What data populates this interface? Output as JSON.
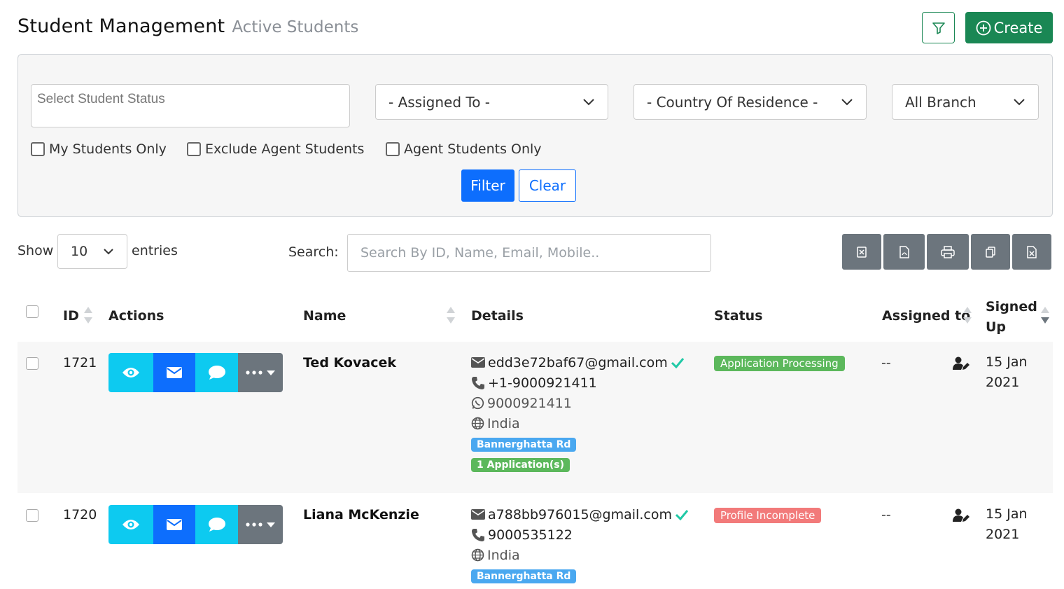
{
  "header": {
    "title": "Student Management",
    "subtitle": "Active Students",
    "create_label": "Create"
  },
  "filters": {
    "status_placeholder": "Select Student Status",
    "assigned_to": "- Assigned To -",
    "country": "- Country Of Residence -",
    "branch": "All Branch",
    "checkbox_my_students": "My Students Only",
    "checkbox_exclude_agent": "Exclude Agent Students",
    "checkbox_agent_only": "Agent Students Only",
    "filter_label": "Filter",
    "clear_label": "Clear"
  },
  "table_controls": {
    "show_label": "Show",
    "entries_value": "10",
    "entries_label": "entries",
    "search_label": "Search:",
    "search_placeholder": "Search By ID, Name, Email, Mobile.."
  },
  "columns": {
    "id": "ID",
    "actions": "Actions",
    "name": "Name",
    "details": "Details",
    "status": "Status",
    "assigned_to": "Assigned to",
    "signed_up": "Signed Up"
  },
  "rows": [
    {
      "id": "1721",
      "name": "Ted Kovacek",
      "email": "edd3e72baf67@gmail.com",
      "phone": "+1-9000921411",
      "whatsapp": "9000921411",
      "country": "India",
      "branch": "Bannerghatta Rd",
      "applications": "1 Application(s)",
      "status": "Application Processing",
      "assigned": "--",
      "signed_day": "15 Jan",
      "signed_year": "2021"
    },
    {
      "id": "1720",
      "name": "Liana McKenzie",
      "email": "a788bb976015@gmail.com",
      "phone": "9000535122",
      "country": "India",
      "branch": "Bannerghatta Rd",
      "status": "Profile Incomplete",
      "assigned": "--",
      "signed_day": "15 Jan",
      "signed_year": "2021"
    }
  ],
  "colors": {
    "primary": "#0d6efd",
    "success": "#1a8754",
    "info": "#0dcaf0",
    "secondary": "#6c757d",
    "badge_processing": "#5cb85c",
    "badge_incomplete": "#f27a7a",
    "tag_branch": "#4aa8f0"
  },
  "icons": [
    "funnel-icon",
    "plus-circle-icon",
    "chevron-down-icon",
    "excel-icon",
    "pdf-icon",
    "print-icon",
    "copy-icon",
    "csv-icon",
    "eye-icon",
    "envelope-icon",
    "chat-icon",
    "ellipsis-icon",
    "caret-down-icon",
    "check-icon",
    "phone-icon",
    "whatsapp-icon",
    "globe-icon",
    "user-edit-icon",
    "sort-icon"
  ]
}
